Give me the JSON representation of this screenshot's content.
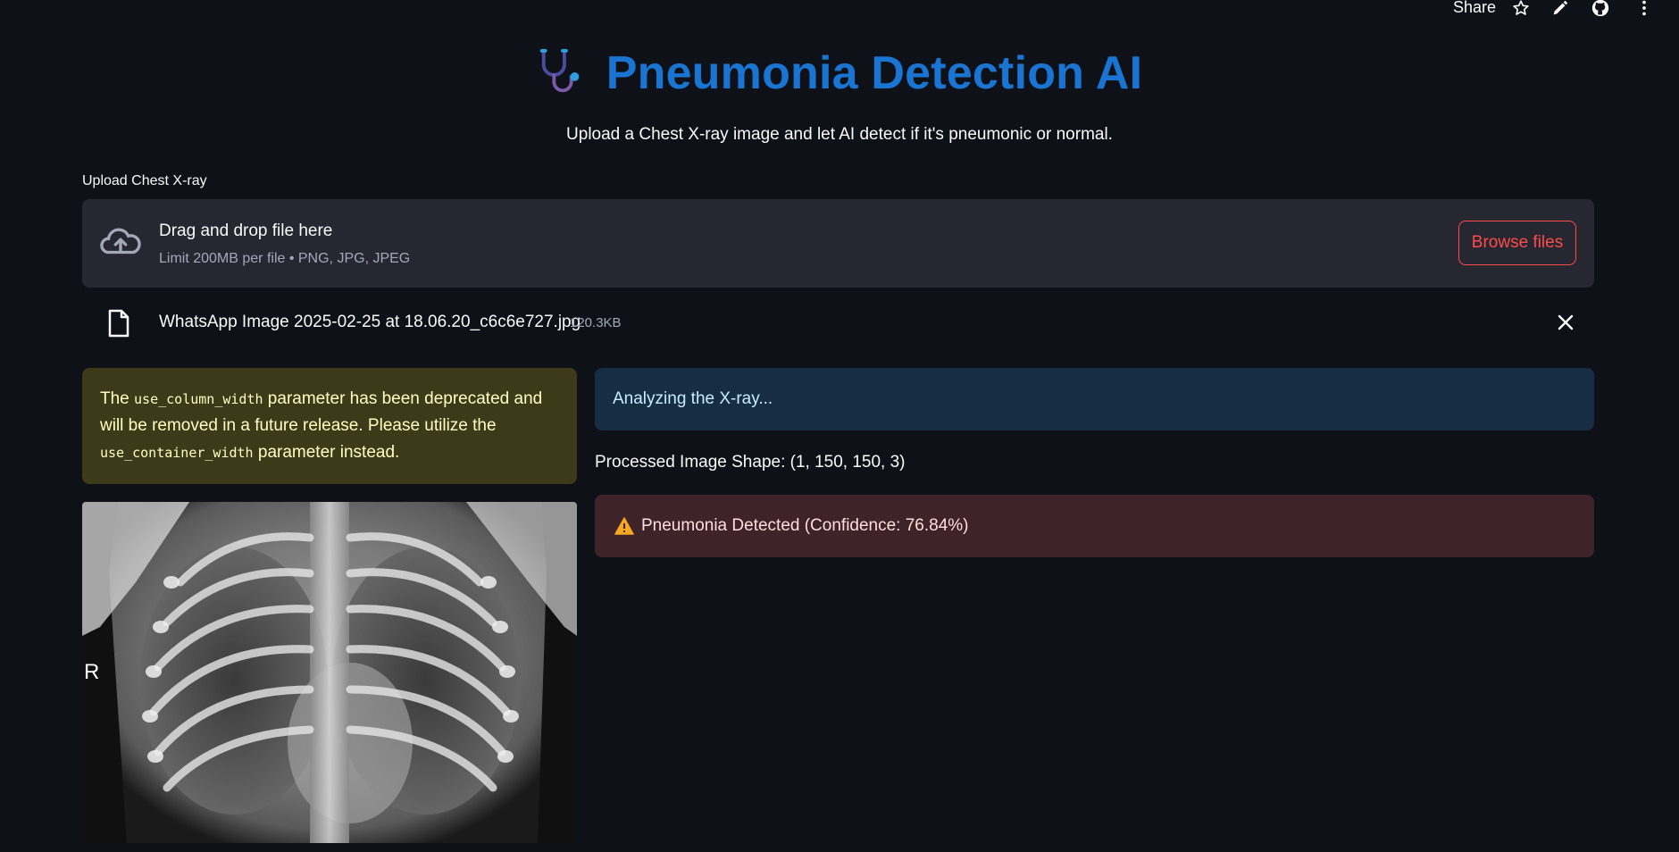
{
  "toolbar": {
    "share_label": "Share",
    "icons": [
      "star-icon",
      "pencil-icon",
      "github-icon",
      "more-vertical-icon"
    ]
  },
  "header": {
    "icon": "stethoscope-icon",
    "title": "Pneumonia Detection AI",
    "subtitle": "Upload a Chest X-ray image and let AI detect if it's pneumonic or normal."
  },
  "uploader": {
    "label": "Upload Chest X-ray",
    "drag_text": "Drag and drop file here",
    "limit_text": "Limit 200MB per file • PNG, JPG, JPEG",
    "browse_label": "Browse files",
    "icon": "cloud-upload-icon"
  },
  "file": {
    "name": "WhatsApp Image 2025-02-25 at 18.06.20_c6c6e727.jpg",
    "size": "120.3KB",
    "icon": "file-icon"
  },
  "deprecation": {
    "part1": "The ",
    "code1": "use_column_width",
    "part2": " parameter has been deprecated and will be removed in a future release. Please utilize the ",
    "code2": "use_container_width",
    "part3": " parameter instead."
  },
  "xray": {
    "marker": "R"
  },
  "results": {
    "status": "Analyzing the X-ray...",
    "shape": "Processed Image Shape: (1, 150, 150, 3)",
    "prediction": "Pneumonia Detected (Confidence: 76.84%)"
  },
  "colors": {
    "background": "#0e1117",
    "title": "#1a75d2",
    "accent_red": "#ff4b4b",
    "warning_bg": "#3d3a1a",
    "info_bg": "#172d43",
    "error_bg": "#3e2428"
  }
}
